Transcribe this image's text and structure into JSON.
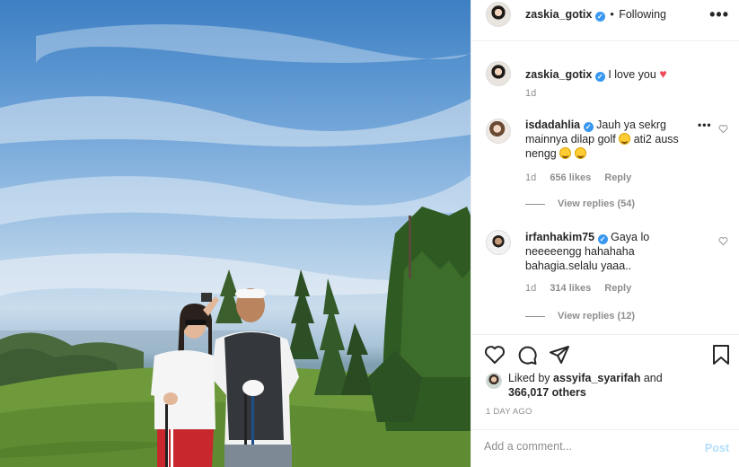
{
  "post": {
    "author": "zaskia_gotix",
    "follow_status": "Following",
    "separator": "•",
    "more_icon": "more-dots-icon"
  },
  "caption": {
    "username": "zaskia_gotix",
    "text": "I love you",
    "time": "1d"
  },
  "comments": [
    {
      "username": "isdadahlia",
      "text_1": "Jauh ya sekrg mainnya dilap golf",
      "text_2": "ati2 auss",
      "text_3": "nengg",
      "time": "1d",
      "likes": "656 likes",
      "reply": "Reply",
      "view_replies": "View replies (54)"
    },
    {
      "username": "irfanhakim75",
      "text": "Gaya lo neeeeengg hahahaha bahagia.selalu yaaa..",
      "time": "1d",
      "likes": "314 likes",
      "reply": "Reply",
      "view_replies": "View replies (12)"
    }
  ],
  "likes": {
    "prefix": "Liked by",
    "user": "assyifa_syarifah",
    "and": "and",
    "count": "366,017 others"
  },
  "time_ago": "1 DAY AGO",
  "comment_input": {
    "placeholder": "Add a comment..."
  },
  "post_button": "Post",
  "colors": {
    "verified": "#3897f0",
    "heart": "#ed4956",
    "muted": "#8e8e8e",
    "post_disabled": "#b2dffc"
  }
}
